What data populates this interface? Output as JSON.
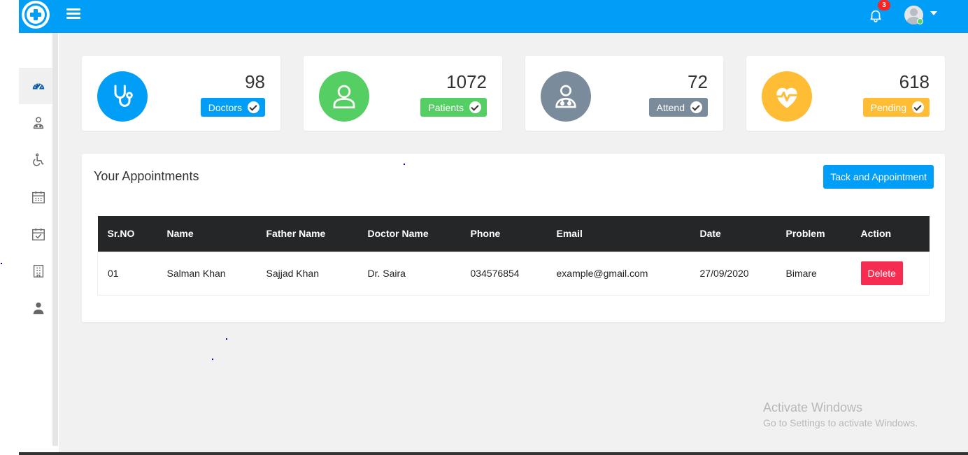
{
  "navbar": {
    "notifications_count": "3",
    "brand_color": "#009ef7"
  },
  "sidebar": {
    "items": [
      {
        "icon": "dashboard-icon",
        "active": true
      },
      {
        "icon": "doctor-icon",
        "active": false
      },
      {
        "icon": "wheelchair-icon",
        "active": false
      },
      {
        "icon": "calendar-icon",
        "active": false
      },
      {
        "icon": "calendar-check-icon",
        "active": false
      },
      {
        "icon": "hospital-building-icon",
        "active": false
      },
      {
        "icon": "user-icon",
        "active": false
      }
    ]
  },
  "stats": [
    {
      "count": "98",
      "label": "Doctors",
      "color": "#009ef7",
      "icon": "stethoscope-icon"
    },
    {
      "count": "1072",
      "label": "Patients",
      "color": "#55ce63",
      "icon": "patient-icon"
    },
    {
      "count": "72",
      "label": "Attend",
      "color": "#7a8b9b",
      "icon": "doctor-icon"
    },
    {
      "count": "618",
      "label": "Pending",
      "color": "#ffbc35",
      "icon": "heartbeat-icon"
    }
  ],
  "appointments": {
    "title": "Your Appointments",
    "action_button": "Tack and Appointment",
    "columns": [
      "Sr.NO",
      "Name",
      "Father Name",
      "Doctor Name",
      "Phone",
      "Email",
      "Date",
      "Problem",
      "Action"
    ],
    "rows": [
      {
        "srno": "01",
        "name": "Salman Khan",
        "father": "Sajjad Khan",
        "doctor": "Dr. Saira",
        "phone": "034576854",
        "email": "example@gmail.com",
        "date": "27/09/2020",
        "problem": "Bimare",
        "action": "Delete"
      }
    ]
  },
  "watermark": {
    "line1": "Activate Windows",
    "line2": "Go to Settings to activate Windows."
  }
}
